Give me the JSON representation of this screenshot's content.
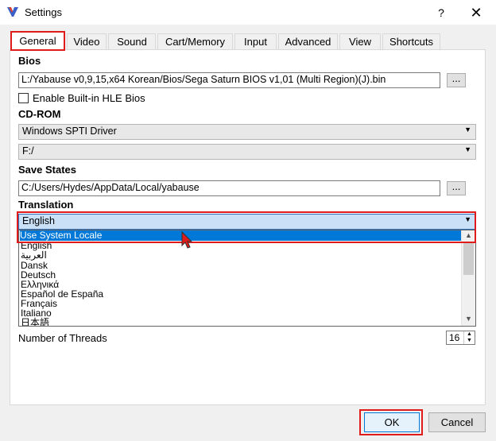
{
  "window": {
    "title": "Settings",
    "help_label": "?",
    "close_label": "✕"
  },
  "tabs": [
    {
      "label": "General",
      "active": true
    },
    {
      "label": "Video"
    },
    {
      "label": "Sound"
    },
    {
      "label": "Cart/Memory"
    },
    {
      "label": "Input"
    },
    {
      "label": "Advanced"
    },
    {
      "label": "View"
    },
    {
      "label": "Shortcuts"
    }
  ],
  "general": {
    "bios": {
      "heading": "Bios",
      "path": "L:/Yabause v0,9,15,x64 Korean/Bios/Sega Saturn BIOS v1,01 (Multi Region)(J).bin",
      "browse_label": "...",
      "hle_label": "Enable Built-in HLE Bios",
      "hle_checked": false
    },
    "cdrom": {
      "heading": "CD-ROM",
      "driver": "Windows SPTI Driver",
      "drive": "F:/"
    },
    "save_states": {
      "heading": "Save States",
      "path": "C:/Users/Hydes/AppData/Local/yabause",
      "browse_label": "..."
    },
    "translation": {
      "heading": "Translation",
      "selected": "English",
      "options": [
        "Use System Locale",
        "English",
        "العربية",
        "Dansk",
        "Deutsch",
        "Ελληνικά",
        "Español de España",
        "Français",
        "Italiano",
        "日本語"
      ],
      "highlighted_index": 0
    },
    "threads": {
      "label": "Number of Threads",
      "value": "16"
    }
  },
  "buttons": {
    "ok": "OK",
    "cancel": "Cancel"
  },
  "colors": {
    "highlight": "#0078d7",
    "annotation_red": "#e01b1b"
  }
}
